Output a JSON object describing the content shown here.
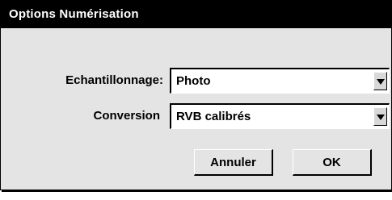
{
  "window": {
    "title": "Options Numérisation"
  },
  "form": {
    "sampling": {
      "label": "Echantillonnage:",
      "value": "Photo"
    },
    "conversion": {
      "label": "Conversion",
      "value": "RVB calibrés"
    }
  },
  "buttons": {
    "cancel_label": "Annuler",
    "ok_label": "OK"
  },
  "icons": {
    "dropdown": "chevron-down-icon"
  },
  "colors": {
    "titlebar": "#000000",
    "title_text": "#ffffff",
    "dialog_background": "#e4e4e4",
    "field_background": "#ffffff"
  }
}
